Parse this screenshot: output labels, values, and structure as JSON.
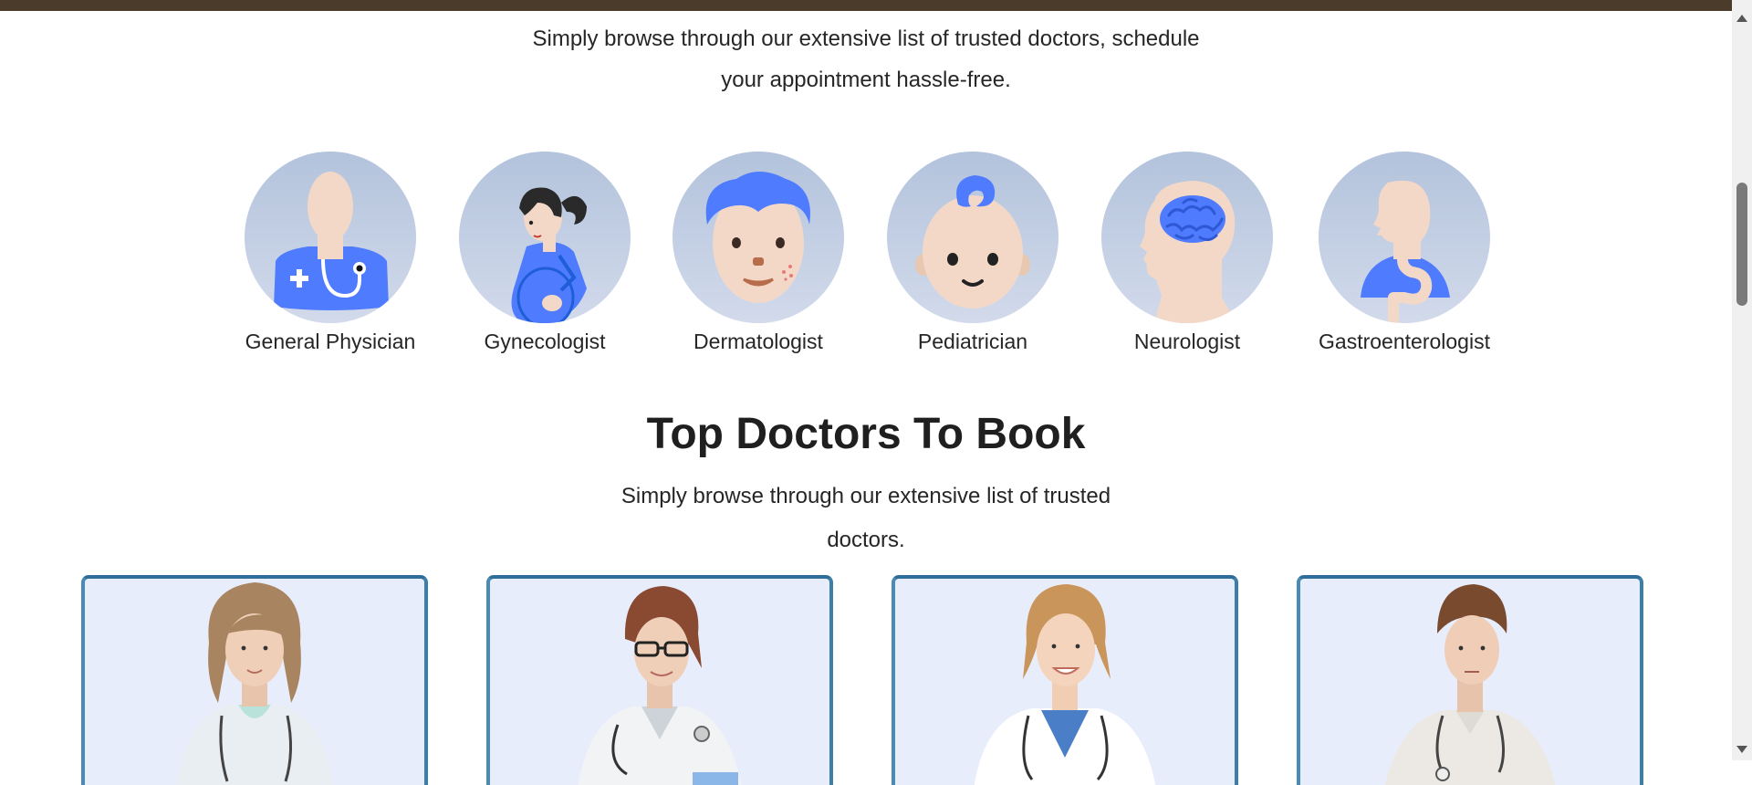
{
  "intro": {
    "line1": "Simply browse through our extensive list of trusted doctors, schedule",
    "line2": "your appointment hassle-free."
  },
  "specialities": [
    {
      "label": "General Physician",
      "icon": "general-physician-icon"
    },
    {
      "label": "Gynecologist",
      "icon": "gynecologist-icon"
    },
    {
      "label": "Dermatologist",
      "icon": "dermatologist-icon"
    },
    {
      "label": "Pediatrician",
      "icon": "pediatrician-icon"
    },
    {
      "label": "Neurologist",
      "icon": "neurologist-icon"
    },
    {
      "label": "Gastroenterologist",
      "icon": "gastroenterologist-icon"
    }
  ],
  "top_doctors": {
    "title": "Top Doctors To Book",
    "subtitle_line1": "Simply browse through our extensive list of trusted",
    "subtitle_line2": "doctors."
  },
  "colors": {
    "accent_blue": "#4f7bff",
    "card_border": "#2f6e9a",
    "card_bg": "#e8edfb",
    "skin": "#f3d8c8",
    "top_bar": "#4a3b2a"
  }
}
